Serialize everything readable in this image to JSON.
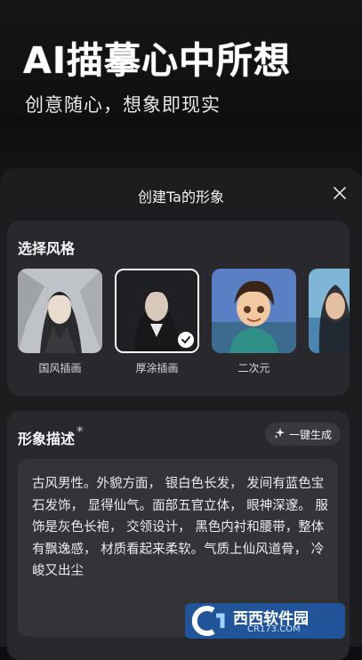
{
  "hero": {
    "title": "AI描摹心中所想",
    "subtitle": "创意随心，想象即现实"
  },
  "sheet": {
    "title": "创建Ta的形象"
  },
  "style_section": {
    "title": "选择风格",
    "items": [
      {
        "label": "国风插画",
        "selected": false
      },
      {
        "label": "厚涂插画",
        "selected": true
      },
      {
        "label": "二次元",
        "selected": false
      },
      {
        "label": "",
        "selected": false
      }
    ]
  },
  "desc_section": {
    "title": "形象描述",
    "required_mark": "*",
    "generate_label": "一键生成",
    "text": "古风男性。外貌方面， 银白色长发， 发间有蓝色宝石发饰， 显得仙气。面部五官立体， 眼神深邃。 服饰是灰色长袍， 交领设计， 黑色内衬和腰带，整体有飘逸感， 材质看起来柔软。气质上仙风道骨， 冷峻又出尘"
  },
  "watermark": {
    "logo_text": "西西软件园",
    "url": "CR173.COM"
  }
}
